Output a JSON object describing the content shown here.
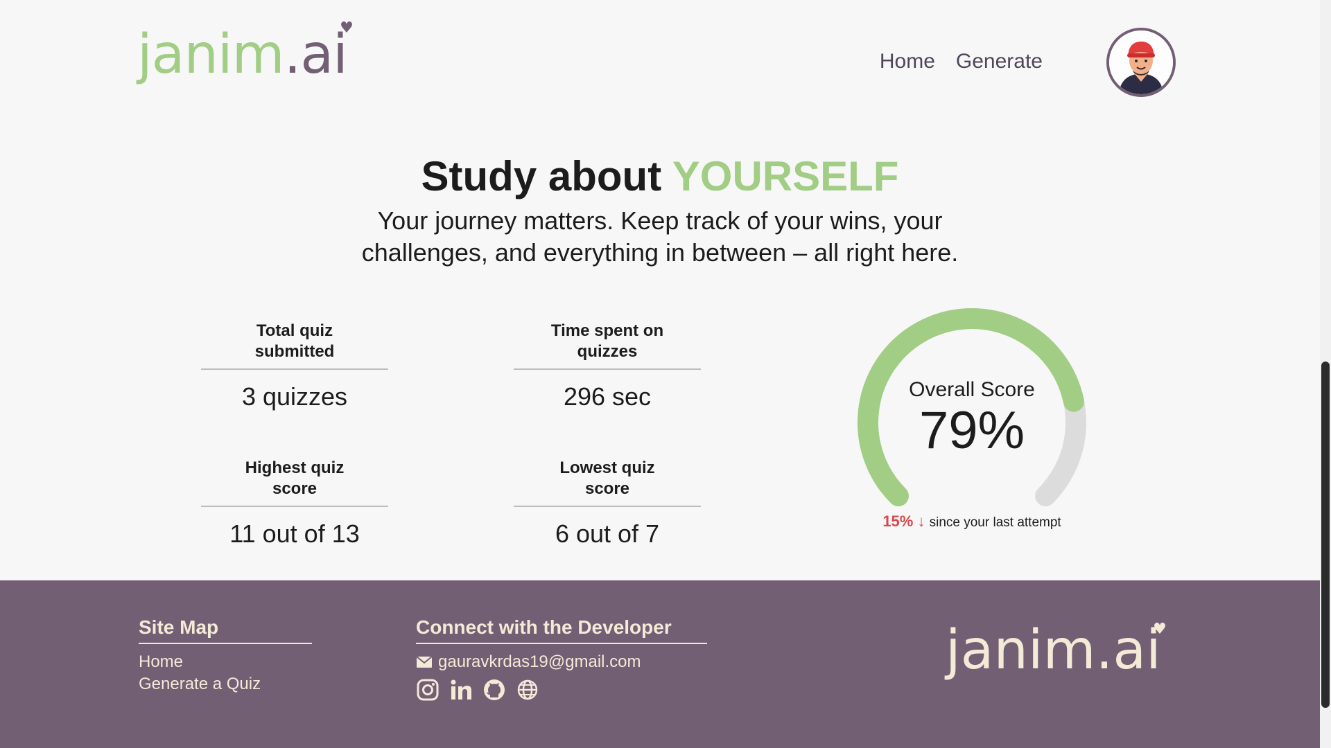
{
  "header": {
    "logo_main": "janim",
    "logo_ext": ".ai",
    "nav": [
      "Home",
      "Generate"
    ]
  },
  "hero": {
    "title_prefix": "Study about",
    "title_accent": "YOURSELF",
    "subtitle": "Your journey matters. Keep track of your wins, your challenges, and everything in between – all right here."
  },
  "stats": [
    {
      "label": "Total quiz submitted",
      "value": "3 quizzes"
    },
    {
      "label": "Time spent on quizzes",
      "value": "296 sec"
    },
    {
      "label": "Highest quiz score",
      "value": "11 out of 13"
    },
    {
      "label": "Lowest quiz score",
      "value": "6 out of 7"
    }
  ],
  "gauge": {
    "label": "Overall Score",
    "value_text": "79%",
    "fraction": 0.79,
    "delta_pct": "15%",
    "delta_text": "since your last attempt"
  },
  "footer": {
    "sitemap_title": "Site Map",
    "sitemap_links": [
      "Home",
      "Generate a Quiz"
    ],
    "connect_title": "Connect with the Developer",
    "email": "gauravkrdas19@gmail.com",
    "social_icons": [
      "instagram-icon",
      "linkedin-icon",
      "github-icon",
      "globe-icon"
    ],
    "logo_main": "janim",
    "logo_ext": ".ai"
  },
  "colors": {
    "accent_green": "#a2cd85",
    "brand_purple": "#735f74",
    "footer_text": "#f3ead7",
    "delta_red": "#d9474b",
    "track_grey": "#dcdcdc"
  }
}
